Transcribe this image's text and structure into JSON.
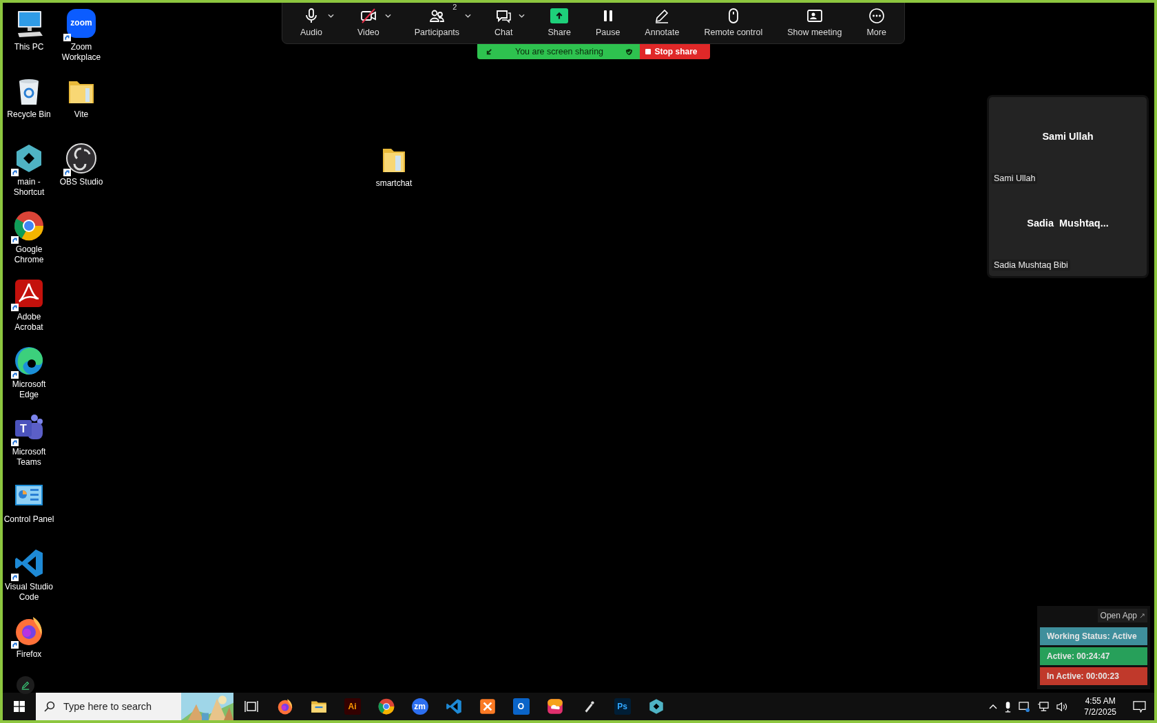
{
  "desktop_icons": [
    {
      "label": "This PC",
      "shortcut": false
    },
    {
      "label": "Recycle Bin",
      "shortcut": false
    },
    {
      "label": "main - Shortcut",
      "shortcut": true
    },
    {
      "label": "Google Chrome",
      "shortcut": true
    },
    {
      "label": "Adobe Acrobat",
      "shortcut": true
    },
    {
      "label": "Microsoft Edge",
      "shortcut": true
    },
    {
      "label": "Microsoft Teams",
      "shortcut": true,
      "logo_text": "T"
    },
    {
      "label": "Control Panel",
      "shortcut": false
    },
    {
      "label": "Visual Studio Code",
      "shortcut": true
    },
    {
      "label": "Firefox",
      "shortcut": true
    },
    {
      "label": "Zoom Workplace",
      "shortcut": true,
      "logo_text": "zoom"
    },
    {
      "label": "Vite",
      "shortcut": false
    },
    {
      "label": "OBS Studio",
      "shortcut": true
    }
  ],
  "loose_icons": [
    {
      "label": "smartchat",
      "shortcut": false
    }
  ],
  "meeting_toolbar": {
    "items": [
      {
        "label": "Audio",
        "caret": true,
        "off": false,
        "highlighted": false
      },
      {
        "label": "Video",
        "caret": true,
        "off": true,
        "highlighted": false
      },
      {
        "label": "Participants",
        "caret": true,
        "off": false,
        "highlighted": false,
        "badge": "2"
      },
      {
        "label": "Chat",
        "caret": true,
        "off": false,
        "highlighted": false
      },
      {
        "label": "Share",
        "caret": false,
        "off": false,
        "highlighted": true
      },
      {
        "label": "Pause",
        "caret": false,
        "off": false,
        "highlighted": false
      },
      {
        "label": "Annotate",
        "caret": false,
        "off": false,
        "highlighted": false
      },
      {
        "label": "Remote control",
        "caret": false,
        "off": false,
        "highlighted": false
      },
      {
        "label": "Show meeting",
        "caret": false,
        "off": false,
        "highlighted": false
      },
      {
        "label": "More",
        "caret": false,
        "off": false,
        "highlighted": false
      }
    ]
  },
  "sharing_banner": {
    "message": "You are screen sharing",
    "stop_button": "Stop share"
  },
  "video_panel": {
    "tiles": [
      {
        "display_name": "Sami Ullah",
        "name_tag": "Sami Ullah"
      },
      {
        "display_name": "Sadia  Mushtaq...",
        "name_tag": "Sadia Mushtaq Bibi"
      }
    ]
  },
  "status_widget": {
    "open_app": "Open App",
    "rows": [
      {
        "text": "Working Status: Active",
        "color": "#3f8f9c"
      },
      {
        "text": "Active: 00:24:47",
        "color": "#27a05a"
      },
      {
        "text": "In Active: 00:00:23",
        "color": "#c0392b"
      }
    ]
  },
  "taskbar": {
    "search": {
      "placeholder": "Type here to search"
    },
    "app_logo_texts": [
      "Ai",
      "zm",
      "O",
      "Ps"
    ],
    "time": "4:55 AM",
    "date": "7/2/2025"
  }
}
